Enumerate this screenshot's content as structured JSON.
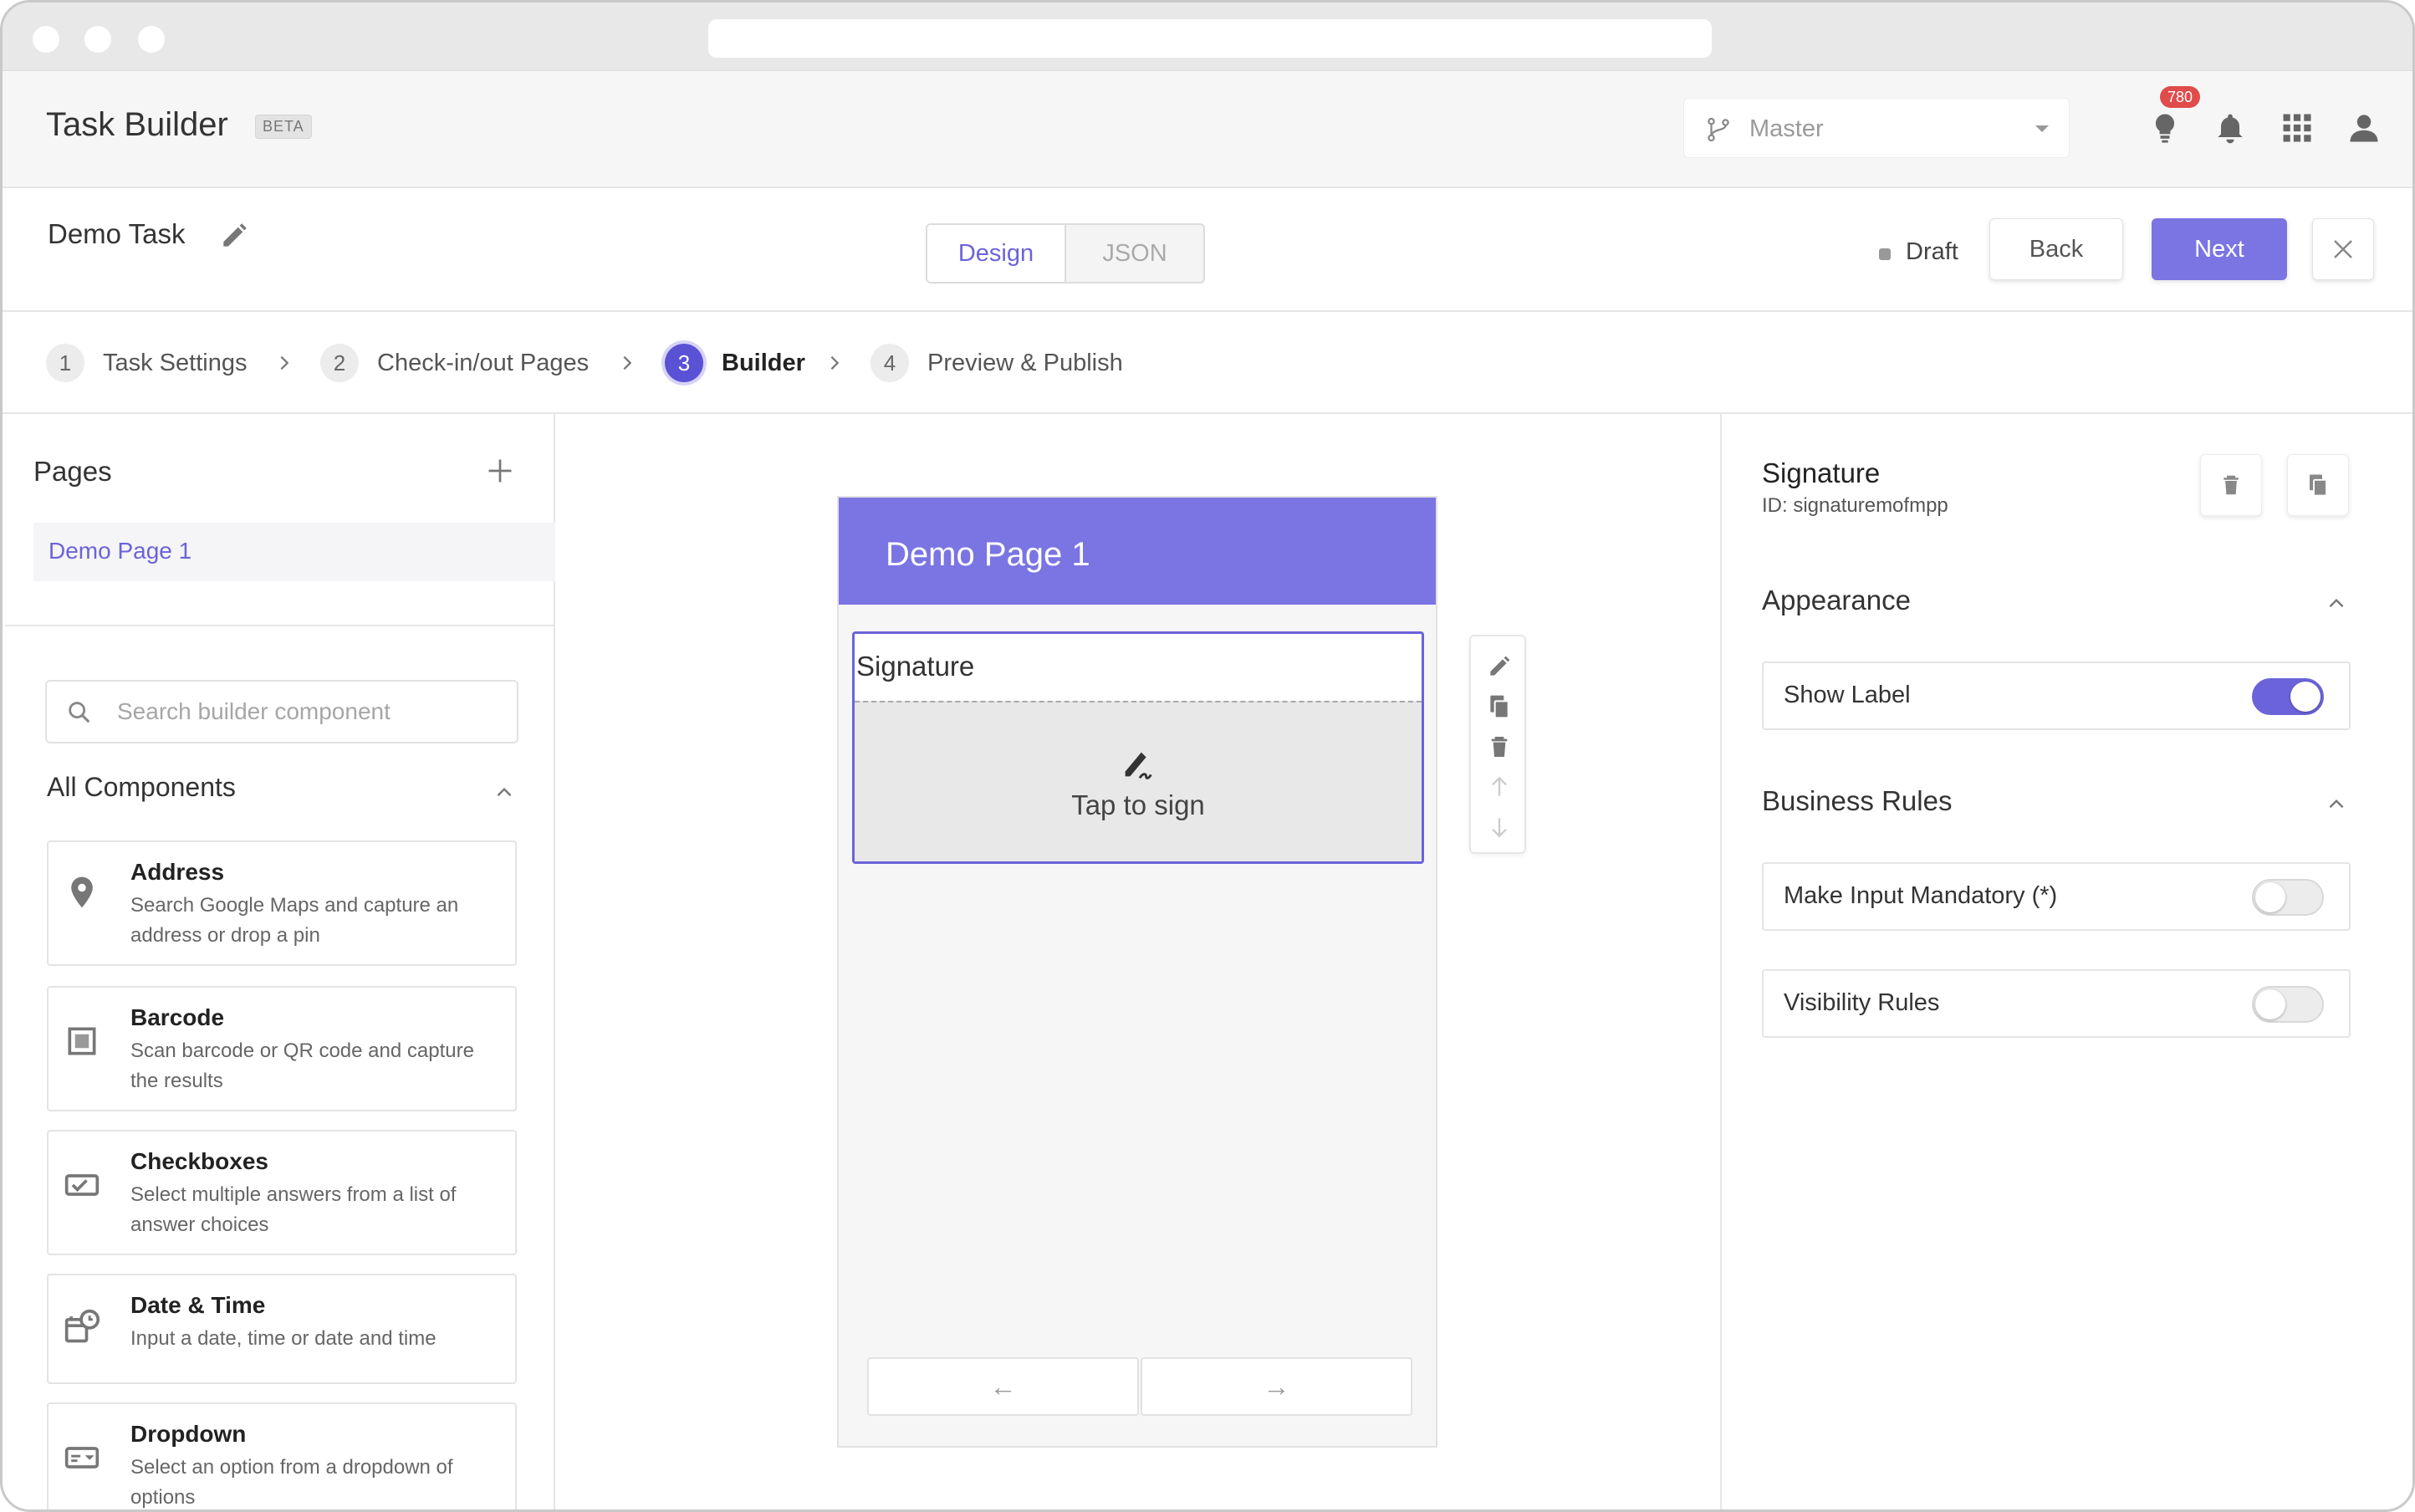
{
  "header": {
    "title": "Task Builder",
    "badge": "BETA",
    "branch": "Master",
    "notification_count": "780",
    "icons": [
      "branch-icon",
      "lightbulb-icon",
      "bell-icon",
      "apps-grid-icon",
      "user-icon"
    ]
  },
  "task": {
    "name": "Demo Task",
    "view_tabs": [
      "Design",
      "JSON"
    ],
    "status": "Draft",
    "back_label": "Back",
    "next_label": "Next"
  },
  "steps": [
    {
      "num": "1",
      "label": "Task Settings"
    },
    {
      "num": "2",
      "label": "Check-in/out Pages"
    },
    {
      "num": "3",
      "label": "Builder"
    },
    {
      "num": "4",
      "label": "Preview & Publish"
    }
  ],
  "pages_panel": {
    "title": "Pages",
    "pages": [
      "Demo Page 1"
    ],
    "search_placeholder": "Search builder component",
    "components_title": "All Components",
    "components": [
      {
        "title": "Address",
        "desc": "Search Google Maps and capture an address or drop a pin",
        "icon": "map-pin-icon"
      },
      {
        "title": "Barcode",
        "desc": "Scan barcode or QR code and capture the results",
        "icon": "barcode-icon"
      },
      {
        "title": "Checkboxes",
        "desc": "Select multiple answers from a list of answer choices",
        "icon": "checkbox-icon"
      },
      {
        "title": "Date & Time",
        "desc": "Input a date, time or date and time",
        "icon": "calendar-clock-icon"
      },
      {
        "title": "Dropdown",
        "desc": "Select an option from a dropdown of options",
        "icon": "dropdown-icon"
      }
    ]
  },
  "canvas": {
    "page_title": "Demo Page 1",
    "field_label": "Signature",
    "sign_prompt": "Tap to sign",
    "nav_prev": "←",
    "nav_next": "→"
  },
  "properties": {
    "title": "Signature",
    "id_text": "ID: signaturemofmpp",
    "appearance_title": "Appearance",
    "show_label": "Show Label",
    "show_label_on": true,
    "business_rules_title": "Business Rules",
    "mandatory": "Make Input Mandatory (*)",
    "mandatory_on": false,
    "visibility": "Visibility Rules",
    "visibility_on": false
  },
  "colors": {
    "accent": "#7b74e3",
    "accent_dark": "#5a52d5",
    "badge_red": "#e04b4b"
  }
}
